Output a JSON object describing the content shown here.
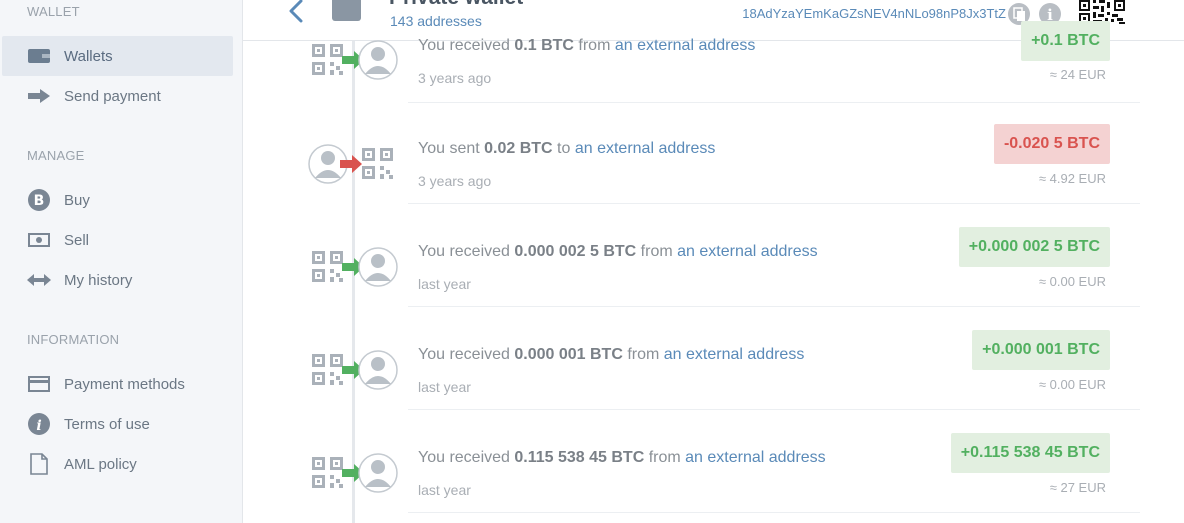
{
  "sidebar": {
    "sections": [
      {
        "title": "WALLET"
      },
      {
        "title": "MANAGE"
      },
      {
        "title": "INFORMATION"
      }
    ],
    "items": [
      {
        "label": "Wallets",
        "icon": "wallet-icon",
        "active": true
      },
      {
        "label": "Send payment",
        "icon": "arrow-right-icon"
      },
      {
        "label": "Buy",
        "icon": "bitcoin-icon"
      },
      {
        "label": "Sell",
        "icon": "banknote-icon"
      },
      {
        "label": "My history",
        "icon": "exchange-icon"
      },
      {
        "label": "Payment methods",
        "icon": "credit-card-icon"
      },
      {
        "label": "Terms of use",
        "icon": "info-icon"
      },
      {
        "label": "AML policy",
        "icon": "document-icon"
      }
    ]
  },
  "header": {
    "title": "Private wallet",
    "subtitle": "143 addresses",
    "address": "18AdYzaYEmKaGZsNEV4nNLo98nP8Jx3TtZ"
  },
  "colors": {
    "accent": "#5a8ab8",
    "received": "#52b060",
    "received_bg": "#e2efe0",
    "sent": "#d9534f",
    "sent_bg": "#f4d2d2"
  },
  "transactions": [
    {
      "direction": "received",
      "prefix": "You received ",
      "amount_text": "0.1 BTC",
      "connector": " from ",
      "counterparty": "an external address",
      "time": "3 years ago",
      "amount": "+0.1 BTC",
      "fiat": "≈ 24 EUR"
    },
    {
      "direction": "sent",
      "prefix": "You sent ",
      "amount_text": "0.02 BTC",
      "connector": " to ",
      "counterparty": "an external address",
      "time": "3 years ago",
      "amount": "-0.020 5 BTC",
      "fiat": "≈ 4.92 EUR"
    },
    {
      "direction": "received",
      "prefix": "You received ",
      "amount_text": "0.000 002 5 BTC",
      "connector": " from ",
      "counterparty": "an external address",
      "time": "last year",
      "amount": "+0.000 002 5 BTC",
      "fiat": "≈ 0.00 EUR"
    },
    {
      "direction": "received",
      "prefix": "You received ",
      "amount_text": "0.000 001 BTC",
      "connector": " from ",
      "counterparty": "an external address",
      "time": "last year",
      "amount": "+0.000 001 BTC",
      "fiat": "≈ 0.00 EUR"
    },
    {
      "direction": "received",
      "prefix": "You received ",
      "amount_text": "0.115 538 45 BTC",
      "connector": " from ",
      "counterparty": "an external address",
      "time": "last year",
      "amount": "+0.115 538 45 BTC",
      "fiat": "≈ 27 EUR"
    }
  ]
}
